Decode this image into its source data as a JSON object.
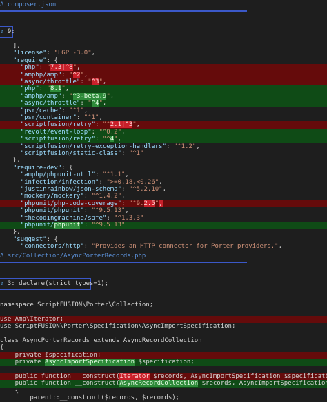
{
  "file1": {
    "icon": "Δ",
    "name": "composer.json",
    "hunk": "9:",
    "lines": [
      {
        "t": "ctx",
        "segs": [
          [
            "p",
            "  ],"
          ]
        ]
      },
      {
        "t": "ctx",
        "segs": [
          [
            "k",
            "  \"license\""
          ],
          [
            "p",
            ": "
          ],
          [
            "s",
            "\"LGPL-3.0\""
          ],
          [
            "p",
            ","
          ]
        ]
      },
      {
        "t": "ctx",
        "segs": [
          [
            "k",
            "  \"require\""
          ],
          [
            "p",
            ": {"
          ]
        ]
      },
      {
        "t": "del",
        "segs": [
          [
            "k",
            "    \"php\""
          ],
          [
            "p",
            ": "
          ],
          [
            "s",
            "\""
          ],
          [
            "hd",
            "7.3|^8"
          ],
          [
            "s",
            "\""
          ],
          [
            "p",
            ","
          ]
        ]
      },
      {
        "t": "del",
        "segs": [
          [
            "k",
            "    \"amphp/amp\""
          ],
          [
            "p",
            ": "
          ],
          [
            "s",
            "\""
          ],
          [
            "hd",
            "^2"
          ],
          [
            "s",
            "\""
          ],
          [
            "p",
            ","
          ]
        ]
      },
      {
        "t": "del",
        "segs": [
          [
            "k",
            "    \"async/throttle\""
          ],
          [
            "p",
            ": "
          ],
          [
            "s",
            "\""
          ],
          [
            "hd",
            "^3"
          ],
          [
            "s",
            "\""
          ],
          [
            "p",
            ","
          ]
        ]
      },
      {
        "t": "add",
        "segs": [
          [
            "k",
            "    \"php\""
          ],
          [
            "p",
            ": "
          ],
          [
            "s",
            "\""
          ],
          [
            "ha",
            "8.1"
          ],
          [
            "s",
            "\""
          ],
          [
            "p",
            ","
          ]
        ]
      },
      {
        "t": "add",
        "segs": [
          [
            "k",
            "    \"amphp/amp\""
          ],
          [
            "p",
            ": "
          ],
          [
            "s",
            "\""
          ],
          [
            "ha",
            "^3-beta.9"
          ],
          [
            "s",
            "\""
          ],
          [
            "p",
            ","
          ]
        ]
      },
      {
        "t": "add",
        "segs": [
          [
            "k",
            "    \"async/throttle\""
          ],
          [
            "p",
            ": "
          ],
          [
            "s",
            "\""
          ],
          [
            "ha",
            "^4"
          ],
          [
            "s",
            "\""
          ],
          [
            "p",
            ","
          ]
        ]
      },
      {
        "t": "ctx",
        "segs": [
          [
            "k",
            "    \"psr/cache\""
          ],
          [
            "p",
            ": "
          ],
          [
            "s",
            "\"^1\""
          ],
          [
            "p",
            ","
          ]
        ]
      },
      {
        "t": "ctx",
        "segs": [
          [
            "k",
            "    \"psr/container\""
          ],
          [
            "p",
            ": "
          ],
          [
            "s",
            "\"^1\""
          ],
          [
            "p",
            ","
          ]
        ]
      },
      {
        "t": "del",
        "segs": [
          [
            "k",
            "    \"scriptfusion/retry\""
          ],
          [
            "p",
            ": "
          ],
          [
            "s",
            "\"^"
          ],
          [
            "hd",
            "2.1|^3"
          ],
          [
            "s",
            "\""
          ],
          [
            "p",
            ","
          ]
        ]
      },
      {
        "t": "add",
        "segs": [
          [
            "k",
            "    \"revolt/event-loop\""
          ],
          [
            "p",
            ": "
          ],
          [
            "s",
            "\"^0.2\""
          ],
          [
            "p",
            ","
          ]
        ]
      },
      {
        "t": "add",
        "segs": [
          [
            "k",
            "    \"scriptfusion/retry\""
          ],
          [
            "p",
            ": "
          ],
          [
            "s",
            "\"^"
          ],
          [
            "ha",
            "4"
          ],
          [
            "s",
            "\""
          ],
          [
            "p",
            ","
          ]
        ]
      },
      {
        "t": "ctx",
        "segs": [
          [
            "k",
            "    \"scriptfusion/retry-exception-handlers\""
          ],
          [
            "p",
            ": "
          ],
          [
            "s",
            "\"^1.2\""
          ],
          [
            "p",
            ","
          ]
        ]
      },
      {
        "t": "ctx",
        "segs": [
          [
            "k",
            "    \"scriptfusion/static-class\""
          ],
          [
            "p",
            ": "
          ],
          [
            "s",
            "\"^1\""
          ]
        ]
      },
      {
        "t": "ctx",
        "segs": [
          [
            "p",
            "  },"
          ]
        ]
      },
      {
        "t": "ctx",
        "segs": [
          [
            "k",
            "  \"require-dev\""
          ],
          [
            "p",
            ": {"
          ]
        ]
      },
      {
        "t": "ctx",
        "segs": [
          [
            "k",
            "    \"amphp/phpunit-util\""
          ],
          [
            "p",
            ": "
          ],
          [
            "s",
            "\"^1.1\""
          ],
          [
            "p",
            ","
          ]
        ]
      },
      {
        "t": "ctx",
        "segs": [
          [
            "k",
            "    \"infection/infection\""
          ],
          [
            "p",
            ": "
          ],
          [
            "s",
            "\">=0.18,<0.26\""
          ],
          [
            "p",
            ","
          ]
        ]
      },
      {
        "t": "ctx",
        "segs": [
          [
            "k",
            "    \"justinrainbow/json-schema\""
          ],
          [
            "p",
            ": "
          ],
          [
            "s",
            "\"^5.2.10\""
          ],
          [
            "p",
            ","
          ]
        ]
      },
      {
        "t": "ctx",
        "segs": [
          [
            "k",
            "    \"mockery/mockery\""
          ],
          [
            "p",
            ": "
          ],
          [
            "s",
            "\"^1.4.2\""
          ],
          [
            "p",
            ","
          ]
        ]
      },
      {
        "t": "del",
        "segs": [
          [
            "k",
            "    \"phpunit/php-code-coverage\""
          ],
          [
            "p",
            ": "
          ],
          [
            "s",
            "\"^9."
          ],
          [
            "hd",
            "2.5"
          ],
          [
            "s",
            "\""
          ],
          [
            "hd",
            ","
          ]
        ]
      },
      {
        "t": "ctx",
        "segs": [
          [
            "k",
            "    \"phpunit/phpunit\""
          ],
          [
            "p",
            ": "
          ],
          [
            "s",
            "\"^9.5.13\""
          ],
          [
            "p",
            ","
          ]
        ]
      },
      {
        "t": "ctx",
        "segs": [
          [
            "k",
            "    \"thecodingmachine/safe\""
          ],
          [
            "p",
            ": "
          ],
          [
            "s",
            "\"^1.3.3\""
          ]
        ]
      },
      {
        "t": "add",
        "segs": [
          [
            "k",
            "    \"phpunit/"
          ],
          [
            "ha",
            "phpunit"
          ],
          [
            "k",
            "\""
          ],
          [
            "p",
            ": "
          ],
          [
            "s",
            "\"^9.5.13\""
          ]
        ]
      },
      {
        "t": "ctx",
        "segs": [
          [
            "p",
            "  },"
          ]
        ]
      },
      {
        "t": "ctx",
        "segs": [
          [
            "k",
            "  \"suggest\""
          ],
          [
            "p",
            ": {"
          ]
        ]
      },
      {
        "t": "ctx",
        "segs": [
          [
            "k",
            "    \"connectors/http\""
          ],
          [
            "p",
            ": "
          ],
          [
            "s",
            "\"Provides an HTTP connector for Porter providers.\""
          ],
          [
            "p",
            ","
          ]
        ]
      }
    ]
  },
  "file2": {
    "icon": "Δ",
    "name": "src/Collection/AsyncPorterRecords.php",
    "hunk": "3: declare(strict_types=1);",
    "lines": [
      {
        "t": "ctx",
        "segs": [
          [
            "php",
            "namespace ScriptFUSION\\Porter\\Collection;"
          ]
        ]
      },
      {
        "t": "ctx",
        "segs": [
          [
            "php",
            ""
          ]
        ]
      },
      {
        "t": "del",
        "segs": [
          [
            "php",
            "use Amp\\Iterator;"
          ]
        ]
      },
      {
        "t": "ctx",
        "segs": [
          [
            "php",
            "use ScriptFUSION\\Porter\\Specification\\AsyncImportSpecification;"
          ]
        ]
      },
      {
        "t": "ctx",
        "segs": [
          [
            "php",
            ""
          ]
        ]
      },
      {
        "t": "ctx",
        "segs": [
          [
            "php",
            "class AsyncPorterRecords extends AsyncRecordCollection"
          ]
        ]
      },
      {
        "t": "ctx",
        "segs": [
          [
            "php",
            "{"
          ]
        ]
      },
      {
        "t": "del",
        "segs": [
          [
            "php",
            "    private $specification;"
          ]
        ]
      },
      {
        "t": "add",
        "segs": [
          [
            "php",
            "    private "
          ],
          [
            "ha",
            "AsyncImportSpecification"
          ],
          [
            "php",
            " $specification;"
          ]
        ]
      },
      {
        "t": "ctx",
        "segs": [
          [
            "php",
            ""
          ]
        ]
      },
      {
        "t": "del",
        "segs": [
          [
            "php",
            "    public function __construct("
          ],
          [
            "hd",
            "Iterator"
          ],
          [
            "php",
            " $records, AsyncImportSpecification $specification)"
          ]
        ]
      },
      {
        "t": "add",
        "segs": [
          [
            "php",
            "    public function __construct("
          ],
          [
            "ha",
            "AsyncRecordCollection"
          ],
          [
            "php",
            " $records, AsyncImportSpecification $specification)"
          ]
        ]
      },
      {
        "t": "ctx",
        "segs": [
          [
            "php",
            "    {"
          ]
        ]
      },
      {
        "t": "ctx",
        "segs": [
          [
            "php",
            "        parent::__construct($records, $records);"
          ]
        ]
      }
    ]
  },
  "colors": {
    "background": "#1e1e1e",
    "deleted": "#650b0b",
    "added": "#0f4b16",
    "accent": "#3b58c8"
  }
}
